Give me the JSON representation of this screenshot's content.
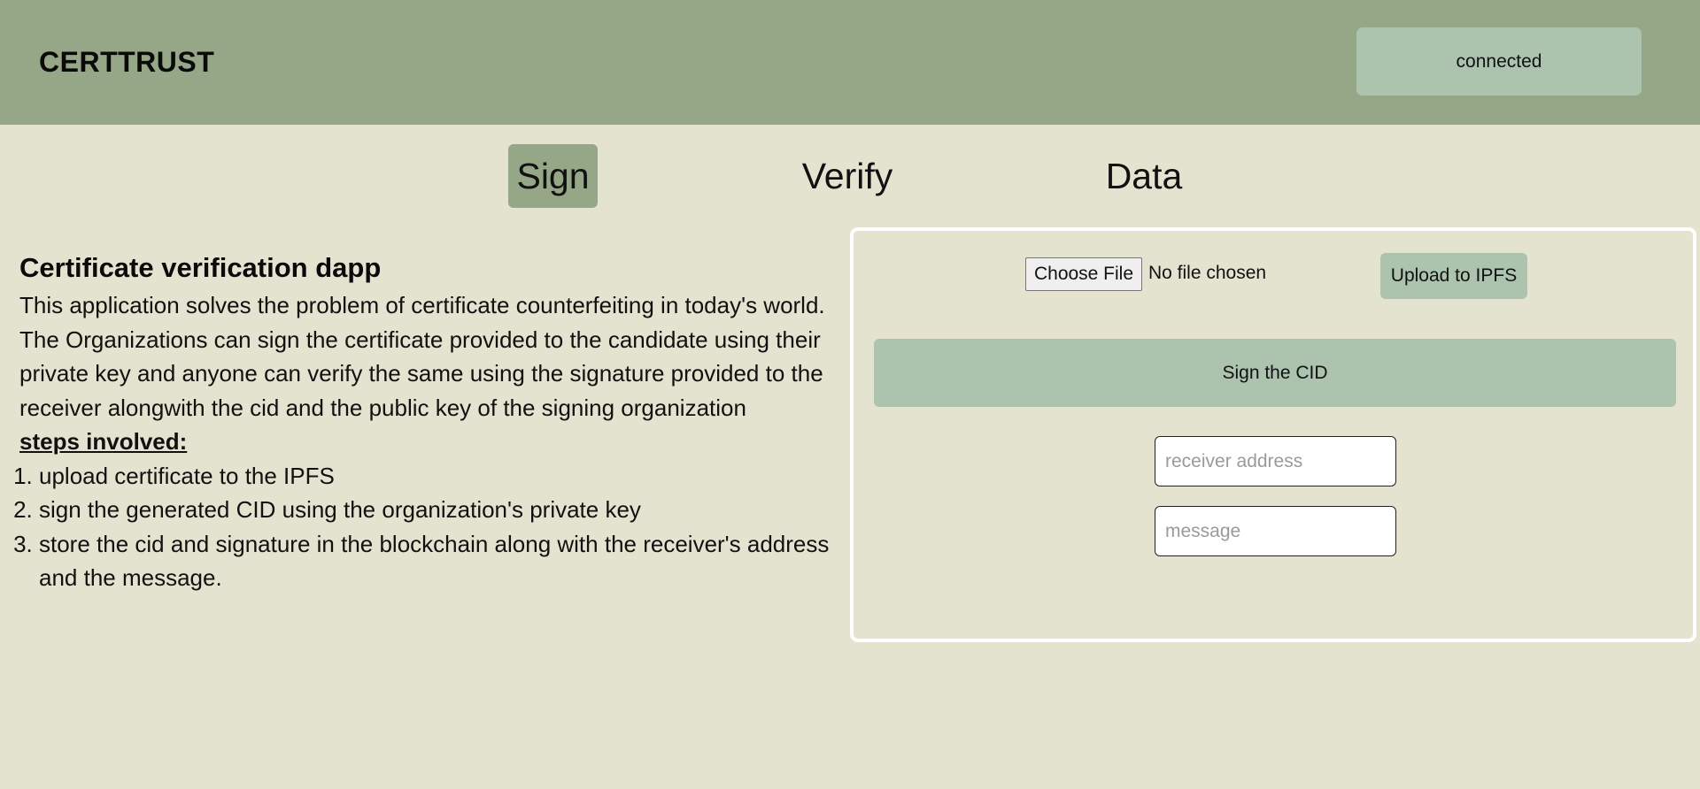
{
  "header": {
    "brand": "CERTTRUST",
    "status": "connected"
  },
  "tabs": [
    {
      "label": "Sign",
      "active": true
    },
    {
      "label": "Verify",
      "active": false
    },
    {
      "label": "Data",
      "active": false
    }
  ],
  "intro": {
    "title": "Certificate verification dapp",
    "description": "This application solves the problem of certificate counterfeiting in today's world. The Organizations can sign the certificate provided to the candidate using their private key and anyone can verify the same using the signature provided to the receiver alongwith the cid and the public key of the signing organization",
    "steps_title": "steps involved:",
    "steps": [
      "upload certificate to the IPFS",
      "sign the generated CID using the organization's private key",
      "store the cid and signature in the blockchain along with the receiver's address and the message."
    ]
  },
  "sign_form": {
    "choose_file_label": "Choose File",
    "file_status": "No file chosen",
    "upload_label": "Upload to IPFS",
    "sign_label": "Sign the CID",
    "receiver_placeholder": "receiver address",
    "receiver_value": "",
    "message_placeholder": "message",
    "message_value": ""
  },
  "colors": {
    "header_bg": "#96a787",
    "page_bg": "#e4e3cf",
    "button_bg": "#acc3ae",
    "active_tab_bg": "#96a787",
    "card_border": "#ffffff"
  }
}
